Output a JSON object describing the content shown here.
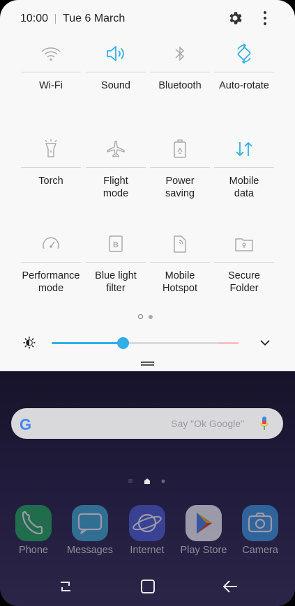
{
  "status": {
    "time": "10:00",
    "date": "Tue 6 March"
  },
  "tiles": [
    {
      "label": "Wi-Fi",
      "icon": "wifi-icon",
      "active": false
    },
    {
      "label": "Sound",
      "icon": "sound-icon",
      "active": true
    },
    {
      "label": "Bluetooth",
      "icon": "bluetooth-icon",
      "active": false
    },
    {
      "label": "Auto-rotate",
      "icon": "auto-rotate-icon",
      "active": true
    },
    {
      "label": "Torch",
      "icon": "torch-icon",
      "active": false
    },
    {
      "label": "Flight\nmode",
      "icon": "airplane-icon",
      "active": false
    },
    {
      "label": "Power\nsaving",
      "icon": "battery-icon",
      "active": false
    },
    {
      "label": "Mobile\ndata",
      "icon": "mobile-data-icon",
      "active": true
    },
    {
      "label": "Performance\nmode",
      "icon": "performance-icon",
      "active": false
    },
    {
      "label": "Blue light\nfilter",
      "icon": "blue-light-icon",
      "active": false
    },
    {
      "label": "Mobile\nHotspot",
      "icon": "hotspot-icon",
      "active": false
    },
    {
      "label": "Secure\nFolder",
      "icon": "secure-folder-icon",
      "active": false
    }
  ],
  "brightness": {
    "level": 0.38
  },
  "search": {
    "placeholder": "Say \"Ok Google\""
  },
  "dock": [
    {
      "label": "Phone",
      "icon": "phone-icon",
      "color": "#1fae58"
    },
    {
      "label": "Messages",
      "icon": "messages-icon",
      "color": "#3bb0d6"
    },
    {
      "label": "Internet",
      "icon": "internet-icon",
      "color": "#4b5fd8"
    },
    {
      "label": "Play Store",
      "icon": "play-store-icon",
      "color": "#ffffff"
    },
    {
      "label": "Camera",
      "icon": "camera-icon",
      "color": "#3a9ee6"
    }
  ],
  "colors": {
    "accent": "#31aee7",
    "icon_inactive": "#a9a9a9",
    "text": "#222222"
  }
}
